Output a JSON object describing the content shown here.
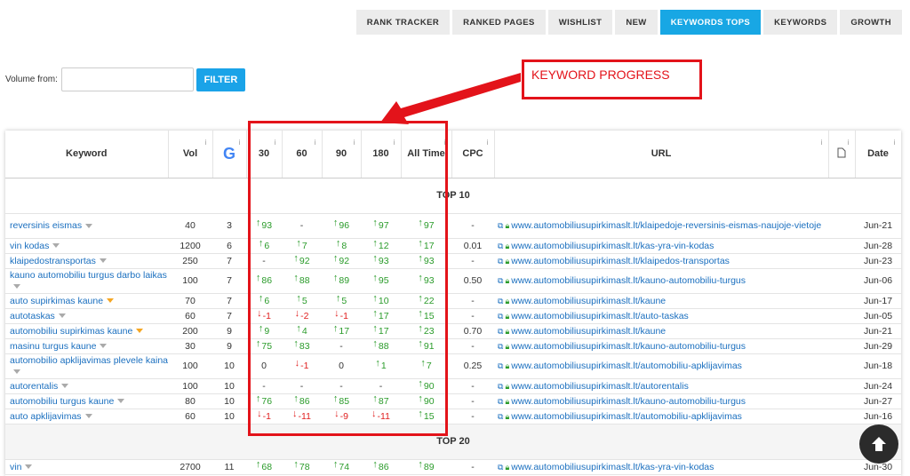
{
  "tabs": [
    {
      "label": "RANK TRACKER",
      "active": false
    },
    {
      "label": "RANKED PAGES",
      "active": false
    },
    {
      "label": "WISHLIST",
      "active": false
    },
    {
      "label": "NEW",
      "active": false
    },
    {
      "label": "KEYWORDS TOPS",
      "active": true
    },
    {
      "label": "KEYWORDS",
      "active": false
    },
    {
      "label": "GROWTH",
      "active": false
    }
  ],
  "filter": {
    "label": "Volume from:",
    "value": "",
    "button": "FILTER"
  },
  "annotation": {
    "text": "KEYWORD PROGRESS",
    "color": "#e3131a"
  },
  "table": {
    "headers": [
      "Keyword",
      "Vol",
      "",
      "30",
      "60",
      "90",
      "180",
      "All Time",
      "CPC",
      "URL",
      "",
      "Date"
    ],
    "sections": [
      {
        "title": "TOP 10",
        "rows": [
          {
            "kw": "reversinis eismas",
            "caret": "gray",
            "vol": "40",
            "g": "3",
            "d30": "↑93",
            "d60": "-",
            "d90": "↑96",
            "d180": "↑97",
            "all": "↑97",
            "cpc": "-",
            "url": "www.automobiliusupirkimaslt.lt/klaipedoje-reversinis-eismas-naujoje-vietoje",
            "date": "Jun-21",
            "tall": true
          },
          {
            "kw": "vin kodas",
            "caret": "gray",
            "vol": "1200",
            "g": "6",
            "d30": "↑6",
            "d60": "↑7",
            "d90": "↑8",
            "d180": "↑12",
            "all": "↑17",
            "cpc": "0.01",
            "url": "www.automobiliusupirkimaslt.lt/kas-yra-vin-kodas",
            "date": "Jun-28"
          },
          {
            "kw": "klaipedostransportas",
            "caret": "gray",
            "vol": "250",
            "g": "7",
            "d30": "-",
            "d60": "↑92",
            "d90": "↑92",
            "d180": "↑93",
            "all": "↑93",
            "cpc": "-",
            "url": "www.automobiliusupirkimaslt.lt/klaipedos-transportas",
            "date": "Jun-23"
          },
          {
            "kw": "kauno automobiliu turgus darbo laikas",
            "caret": "gray",
            "vol": "100",
            "g": "7",
            "d30": "↑86",
            "d60": "↑88",
            "d90": "↑89",
            "d180": "↑95",
            "all": "↑93",
            "cpc": "0.50",
            "url": "www.automobiliusupirkimaslt.lt/kauno-automobiliu-turgus",
            "date": "Jun-06",
            "tall": true
          },
          {
            "kw": "auto supirkimas kaune",
            "caret": "star",
            "vol": "70",
            "g": "7",
            "d30": "↑6",
            "d60": "↑5",
            "d90": "↑5",
            "d180": "↑10",
            "all": "↑22",
            "cpc": "-",
            "url": "www.automobiliusupirkimaslt.lt/kaune",
            "date": "Jun-17"
          },
          {
            "kw": "autotaskas",
            "caret": "gray",
            "vol": "60",
            "g": "7",
            "d30": "↓-1",
            "d60": "↓-2",
            "d90": "↓-1",
            "d180": "↑17",
            "all": "↑15",
            "cpc": "-",
            "url": "www.automobiliusupirkimaslt.lt/auto-taskas",
            "date": "Jun-05"
          },
          {
            "kw": "automobiliu supirkimas kaune",
            "caret": "star",
            "vol": "200",
            "g": "9",
            "d30": "↑9",
            "d60": "↑4",
            "d90": "↑17",
            "d180": "↑17",
            "all": "↑23",
            "cpc": "0.70",
            "url": "www.automobiliusupirkimaslt.lt/kaune",
            "date": "Jun-21"
          },
          {
            "kw": "masinu turgus kaune",
            "caret": "gray",
            "vol": "30",
            "g": "9",
            "d30": "↑75",
            "d60": "↑83",
            "d90": "-",
            "d180": "↑88",
            "all": "↑91",
            "cpc": "-",
            "url": "www.automobiliusupirkimaslt.lt/kauno-automobiliu-turgus",
            "date": "Jun-29"
          },
          {
            "kw": "automobilio apklijavimas plevele kaina",
            "caret": "gray",
            "vol": "100",
            "g": "10",
            "d30": "0",
            "d60": "↓-1",
            "d90": "0",
            "d180": "↑1",
            "all": "↑7",
            "cpc": "0.25",
            "url": "www.automobiliusupirkimaslt.lt/automobiliu-apklijavimas",
            "date": "Jun-18",
            "tall": true
          },
          {
            "kw": "autorentalis",
            "caret": "gray",
            "vol": "100",
            "g": "10",
            "d30": "-",
            "d60": "-",
            "d90": "-",
            "d180": "-",
            "all": "↑90",
            "cpc": "-",
            "url": "www.automobiliusupirkimaslt.lt/autorentalis",
            "date": "Jun-24"
          },
          {
            "kw": "automobiliu turgus kaune",
            "caret": "gray",
            "vol": "80",
            "g": "10",
            "d30": "↑76",
            "d60": "↑86",
            "d90": "↑85",
            "d180": "↑87",
            "all": "↑90",
            "cpc": "-",
            "url": "www.automobiliusupirkimaslt.lt/kauno-automobiliu-turgus",
            "date": "Jun-27"
          },
          {
            "kw": "auto apklijavimas",
            "caret": "gray",
            "vol": "60",
            "g": "10",
            "d30": "↓-1",
            "d60": "↓-11",
            "d90": "↓-9",
            "d180": "↓-11",
            "all": "↑15",
            "cpc": "-",
            "url": "www.automobiliusupirkimaslt.lt/automobiliu-apklijavimas",
            "date": "Jun-16"
          }
        ]
      },
      {
        "title": "TOP 20",
        "rows": [
          {
            "kw": "vin",
            "caret": "gray",
            "vol": "2700",
            "g": "11",
            "d30": "↑68",
            "d60": "↑78",
            "d90": "↑74",
            "d180": "↑86",
            "all": "↑89",
            "cpc": "-",
            "url": "www.automobiliusupirkimaslt.lt/kas-yra-vin-kodas",
            "date": "Jun-30"
          }
        ]
      }
    ]
  }
}
